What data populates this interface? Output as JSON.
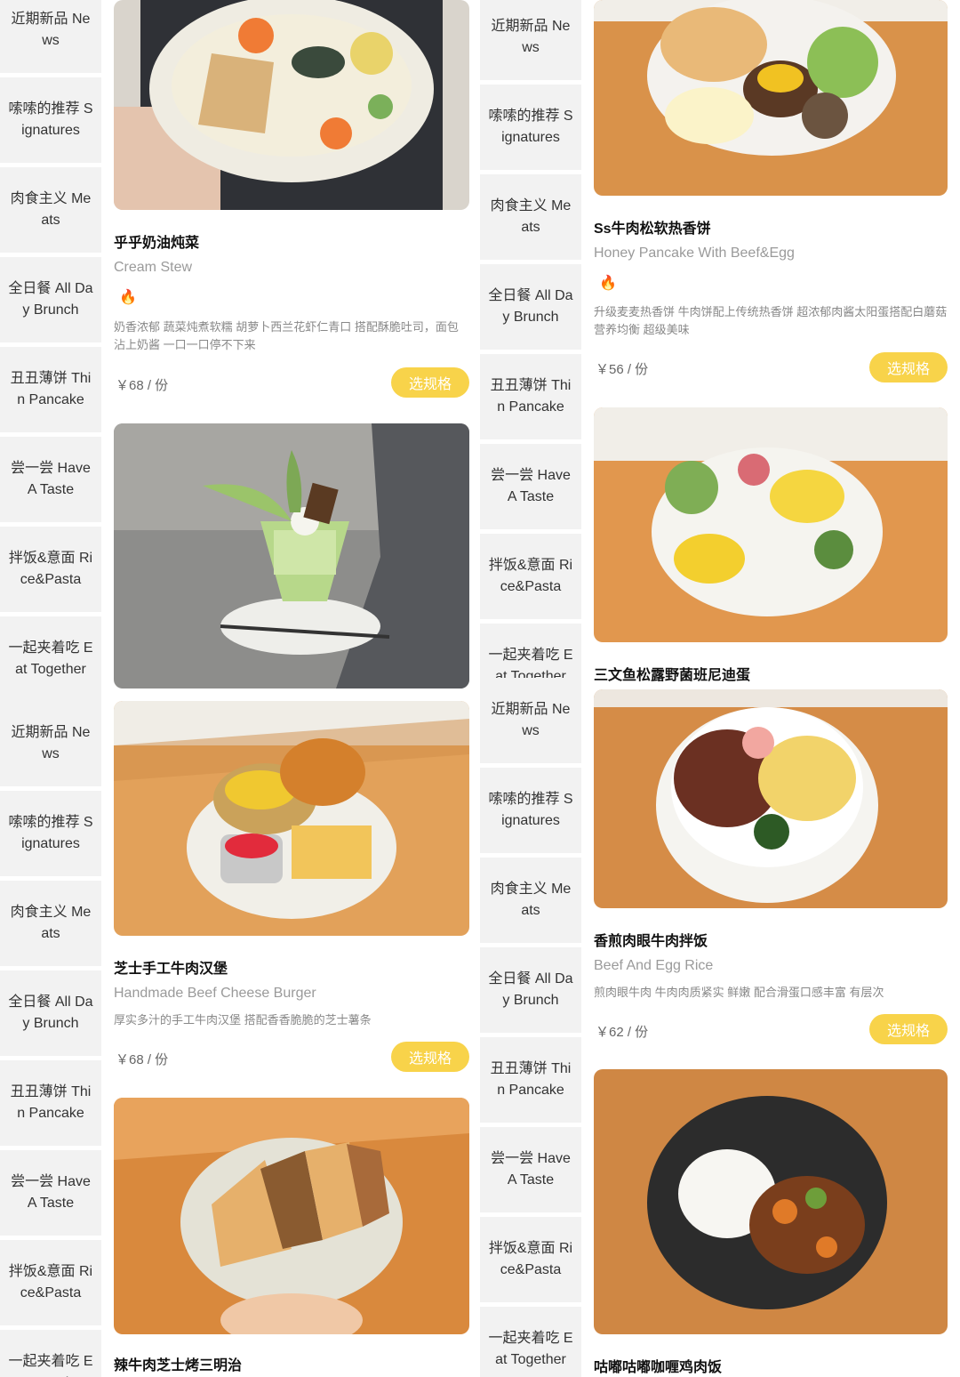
{
  "categories": [
    "近期新品 News",
    "嗦嗦的推荐 Signatures",
    "肉食主义 Meats",
    "全日餐 All Day Brunch",
    "丑丑薄饼 Thin Pancake",
    "尝一尝 Have A Taste",
    "拌饭&意面 Rice&Pasta",
    "一起夹着吃 Eat Together"
  ],
  "categories_display": [
    "近期新品 Ne ws",
    "嗦嗦的推荐 S ignatures",
    "肉食主义 Me ats",
    "全日餐 All Da y Brunch",
    "丑丑薄饼 Thi n Pancake",
    "尝一尝 Have A Taste",
    "拌饭&意面 Ri ce&Pasta",
    "一起夹着吃 E at Together"
  ],
  "spec_button_label": "选规格",
  "fire_icon": "🔥",
  "dishes": {
    "cream_stew": {
      "name": "乎乎奶油炖菜",
      "en": "Cream Stew",
      "desc": "奶香浓郁 蔬菜炖煮软糯 胡萝卜西兰花虾仁青口 搭配酥脆吐司，面包 沾上奶酱 一口一口停不下来",
      "price": "￥68 / 份"
    },
    "beef_burger": {
      "name": "芝士手工牛肉汉堡",
      "en": "Handmade Beef Cheese Burger",
      "desc": "厚实多汁的手工牛肉汉堡 搭配香香脆脆的芝士薯条",
      "price": "￥68 / 份"
    },
    "beef_sandwich": {
      "name": "辣牛肉芝士烤三明治"
    },
    "pancake": {
      "name": "Ss牛肉松软热香饼",
      "en": "Honey Pancake With Beef&Egg",
      "desc": "升级麦麦热香饼 牛肉饼配上传统热香饼 超浓郁肉酱太阳蛋搭配白蘑菇 营养均衡 超级美味",
      "price": "￥56 / 份"
    },
    "salmon_benedict": {
      "name": "三文鱼松露野菌班尼迪蛋"
    },
    "beef_rice": {
      "name": "香煎肉眼牛肉拌饭",
      "en": "Beef And Egg Rice",
      "desc": "煎肉眼牛肉 牛肉肉质紧实 鲜嫩 配合滑蛋口感丰富 有层次",
      "price": "￥62 / 份"
    },
    "curry_rice": {
      "name": "咕嘟咕嘟咖喱鸡肉饭"
    }
  }
}
